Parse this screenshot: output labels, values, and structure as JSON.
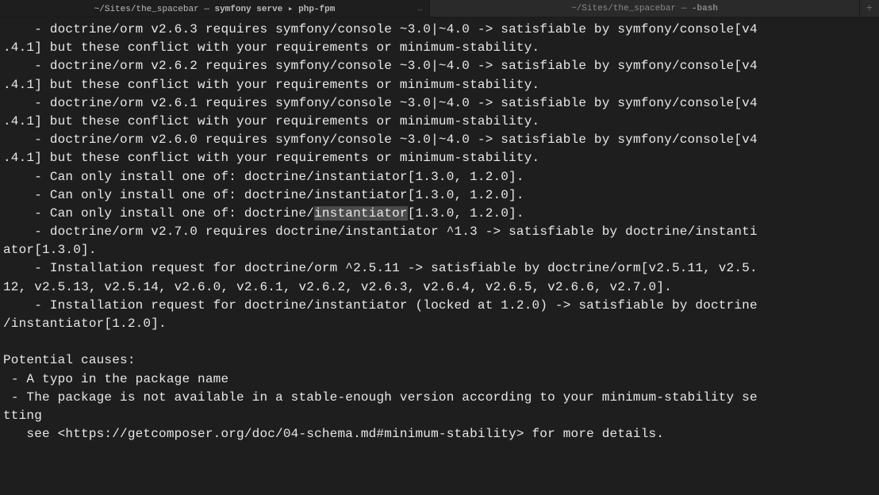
{
  "tabs": [
    {
      "path": "~/Sites/the_spacebar — ",
      "cmd": "symfony serve ▸ php-fpm",
      "ellipsis": "…"
    },
    {
      "path": "~/Sites/the_spacebar — ",
      "cmd": "-bash",
      "ellipsis": ""
    }
  ],
  "lines": {
    "l1a": "    - doctrine/orm v2.6.3 requires symfony/console ~3.0|~4.0 -> satisfiable by symfony/console[v4",
    "l1b": ".4.1] but these conflict with your requirements or minimum-stability.",
    "l2a": "    - doctrine/orm v2.6.2 requires symfony/console ~3.0|~4.0 -> satisfiable by symfony/console[v4",
    "l2b": ".4.1] but these conflict with your requirements or minimum-stability.",
    "l3a": "    - doctrine/orm v2.6.1 requires symfony/console ~3.0|~4.0 -> satisfiable by symfony/console[v4",
    "l3b": ".4.1] but these conflict with your requirements or minimum-stability.",
    "l4a": "    - doctrine/orm v2.6.0 requires symfony/console ~3.0|~4.0 -> satisfiable by symfony/console[v4",
    "l4b": ".4.1] but these conflict with your requirements or minimum-stability.",
    "l5": "    - Can only install one of: doctrine/instantiator[1.3.0, 1.2.0].",
    "l6": "    - Can only install one of: doctrine/instantiator[1.3.0, 1.2.0].",
    "l7pre": "    - Can only install one of: doctrine/",
    "l7hl": "instantiator",
    "l7post": "[1.3.0, 1.2.0].",
    "l8a": "    - doctrine/orm v2.7.0 requires doctrine/instantiator ^1.3 -> satisfiable by doctrine/instanti",
    "l8b": "ator[1.3.0].",
    "l9a": "    - Installation request for doctrine/orm ^2.5.11 -> satisfiable by doctrine/orm[v2.5.11, v2.5.",
    "l9b": "12, v2.5.13, v2.5.14, v2.6.0, v2.6.1, v2.6.2, v2.6.3, v2.6.4, v2.6.5, v2.6.6, v2.7.0].",
    "l10a": "    - Installation request for doctrine/instantiator (locked at 1.2.0) -> satisfiable by doctrine",
    "l10b": "/instantiator[1.2.0].",
    "blank1": "",
    "l11": "Potential causes:",
    "l12": " - A typo in the package name",
    "l13a": " - The package is not available in a stable-enough version according to your minimum-stability se",
    "l13b": "tting",
    "l14": "   see <https://getcomposer.org/doc/04-schema.md#minimum-stability> for more details."
  }
}
